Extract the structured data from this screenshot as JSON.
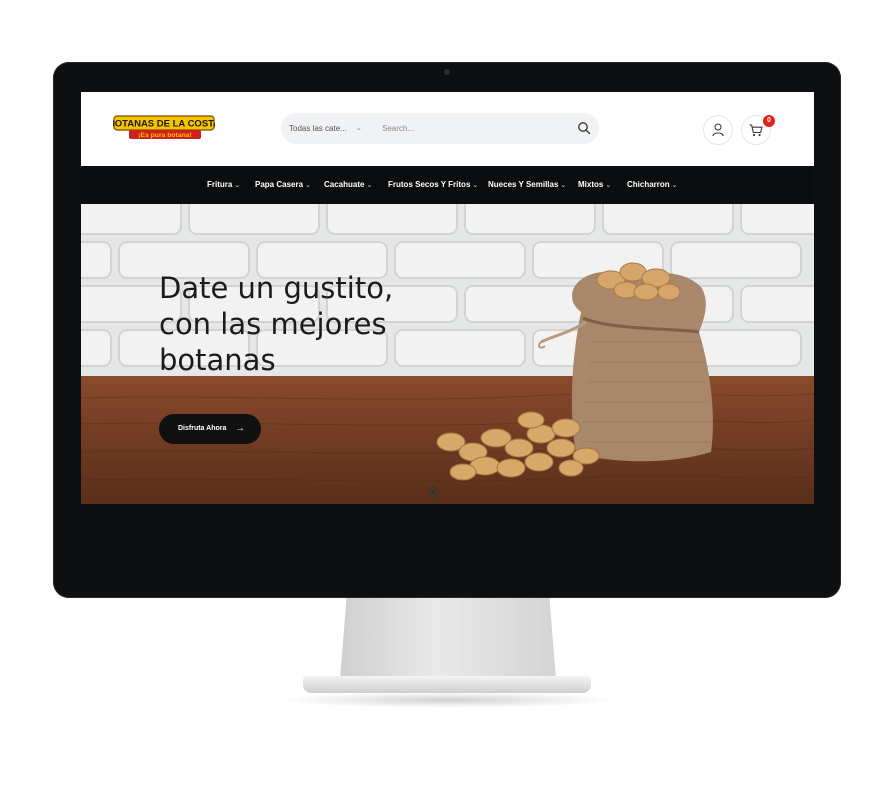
{
  "header": {
    "logo_line1": "BOTANAS DE LA COSTA",
    "logo_line2": "¡Es pura botana!",
    "search": {
      "category": "Todas las cate...",
      "placeholder": "Search..."
    },
    "cart_count": "0"
  },
  "nav": {
    "items": [
      {
        "label": "Fritura"
      },
      {
        "label": "Papa Casera"
      },
      {
        "label": "Cacahuate"
      },
      {
        "label": "Frutos Secos Y Fritos"
      },
      {
        "label": "Nueces Y Semillas"
      },
      {
        "label": "Mixtos"
      },
      {
        "label": "Chicharron"
      }
    ]
  },
  "hero": {
    "headline_line1": "Date un gustito,",
    "headline_line2": "con las mejores",
    "headline_line3": "botanas",
    "cta_label": "Disfruta Ahora",
    "cta_arrow": "→"
  },
  "colors": {
    "nav_bg": "#0c0d0e",
    "cta_bg": "#111111",
    "badge": "#e2231a",
    "logo_yellow": "#f5c400",
    "logo_red": "#d0201b"
  },
  "icons": [
    "search-icon",
    "user-icon",
    "cart-icon",
    "chevron-down-icon",
    "arrow-right-icon"
  ]
}
